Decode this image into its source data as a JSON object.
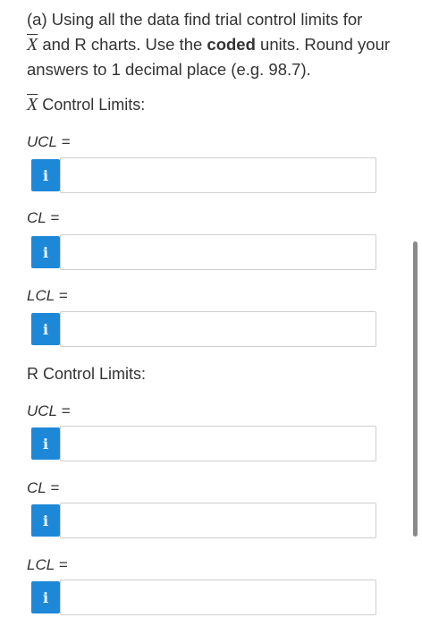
{
  "question": {
    "part1": "(a) Using all the data find trial control limits for",
    "xbar_symbol": "X",
    "part2": " and R charts. Use the ",
    "bold": "coded",
    "part3": " units. Round your answers to 1 decimal place (e.g. 98.7)."
  },
  "xbar_section": {
    "symbol": "X",
    "title": " Control Limits:"
  },
  "r_section": {
    "title": "R Control Limits:"
  },
  "fields": {
    "x_ucl": {
      "label": "UCL",
      "eq": " =",
      "value": ""
    },
    "x_cl": {
      "label": "CL",
      "eq": " =",
      "value": ""
    },
    "x_lcl": {
      "label": "LCL",
      "eq": " =",
      "value": ""
    },
    "r_ucl": {
      "label": "UCL",
      "eq": " =",
      "value": ""
    },
    "r_cl": {
      "label": "CL",
      "eq": " =",
      "value": ""
    },
    "r_lcl": {
      "label": "LCL",
      "eq": " =",
      "value": ""
    }
  },
  "info_button": {
    "glyph": "i",
    "icon": "info-icon",
    "color": "#1e88d8"
  }
}
